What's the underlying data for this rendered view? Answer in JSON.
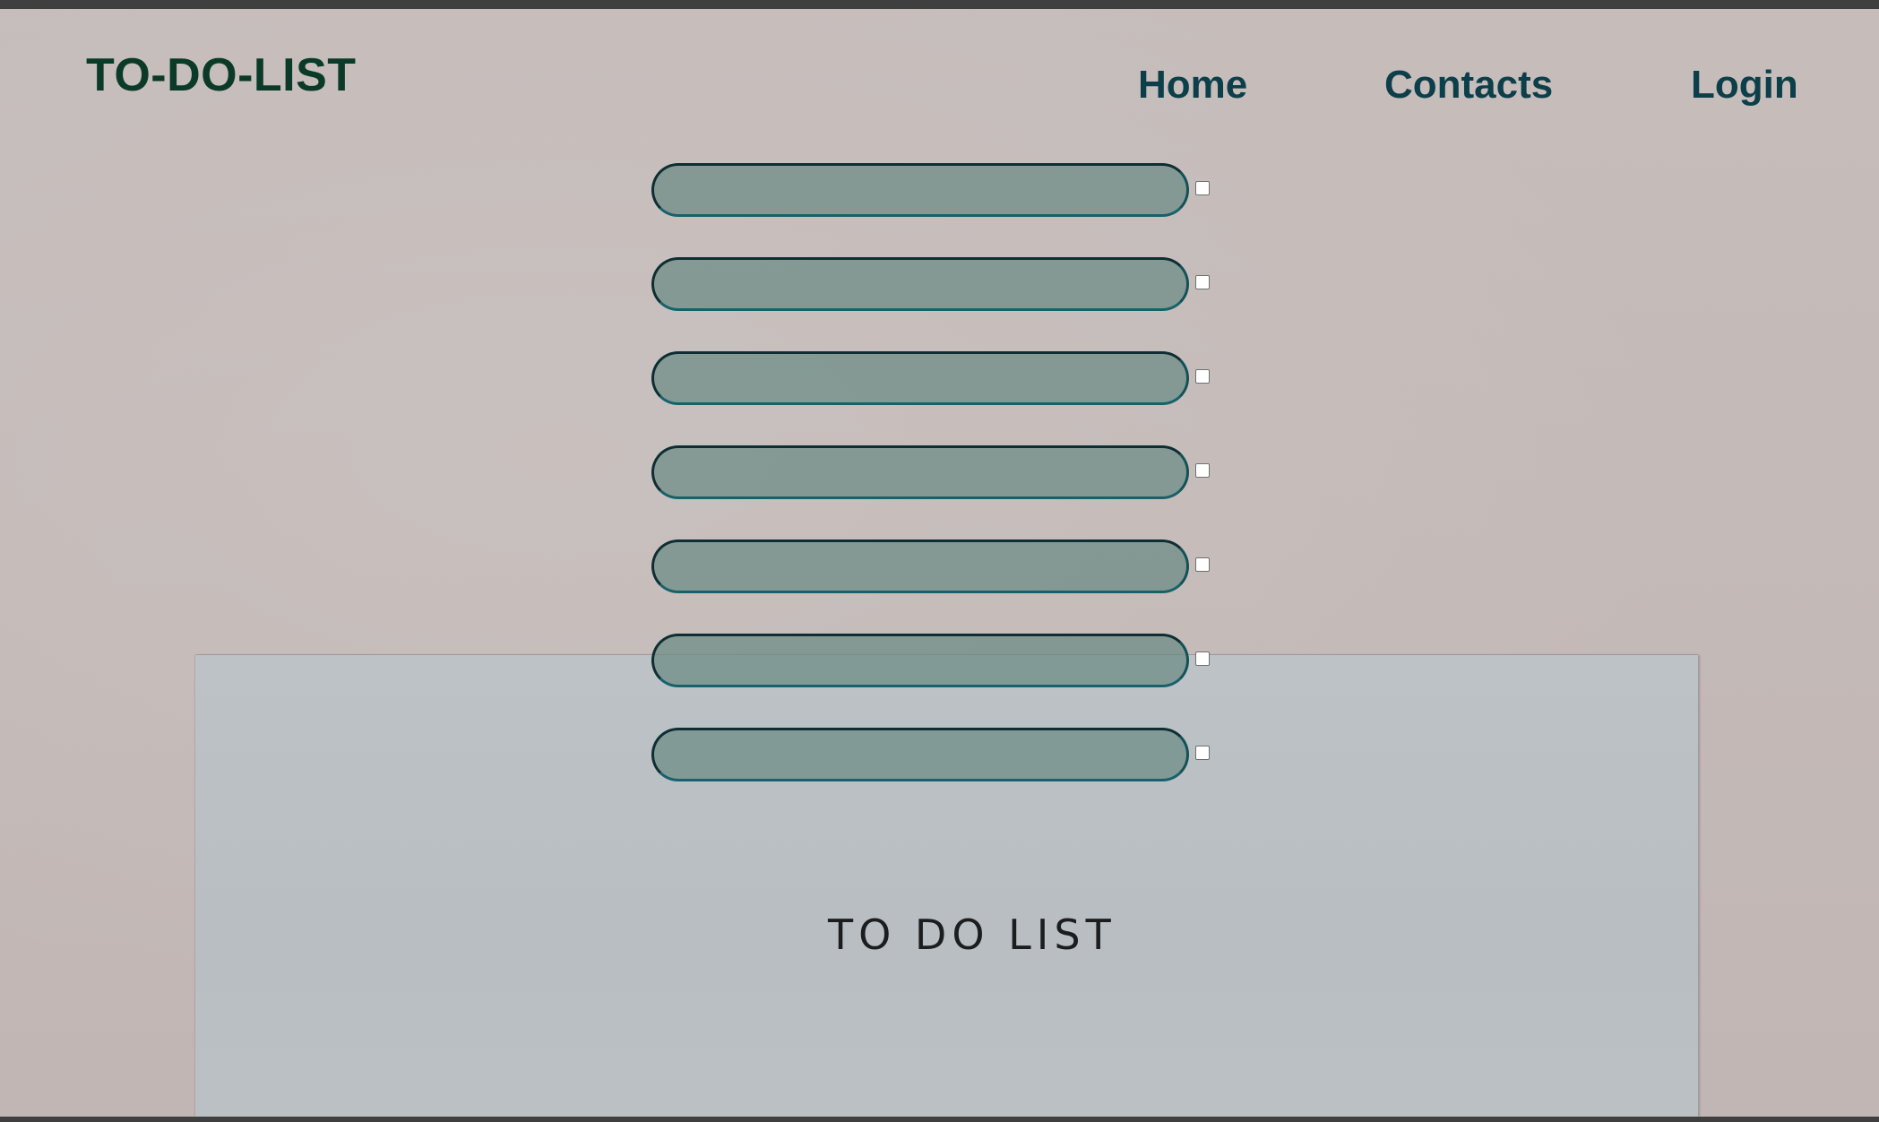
{
  "header": {
    "brand": "TO-DO-LIST",
    "nav": [
      {
        "label": "Home"
      },
      {
        "label": "Contacts"
      },
      {
        "label": "Login"
      }
    ]
  },
  "tasks": [
    {
      "value": "",
      "checked": false
    },
    {
      "value": "",
      "checked": false
    },
    {
      "value": "",
      "checked": false
    },
    {
      "value": "",
      "checked": false
    },
    {
      "value": "",
      "checked": false
    },
    {
      "value": "",
      "checked": false
    },
    {
      "value": "",
      "checked": false
    }
  ],
  "background": {
    "paper_text": "TO DO LIST"
  },
  "colors": {
    "brand": "#0b3b28",
    "nav": "#0c3f4a",
    "input_fill": "#6b8b83",
    "input_border": "#17626a",
    "page_bg": "#c3b8b6",
    "paper": "#bcc2c6"
  }
}
